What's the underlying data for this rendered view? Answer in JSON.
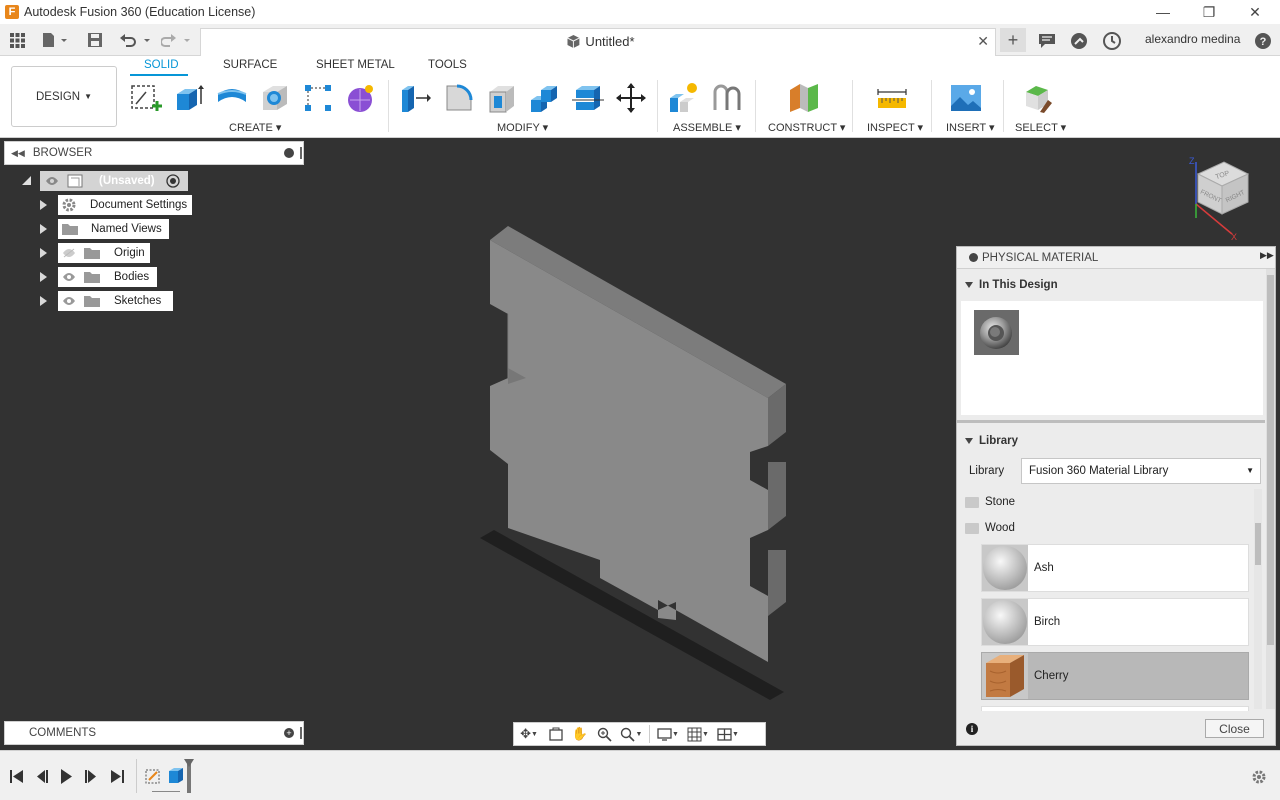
{
  "app": {
    "title": "Autodesk Fusion 360 (Education License)",
    "logo_letter": "F"
  },
  "document": {
    "tab_title": "Untitled*"
  },
  "user": {
    "name": "alexandro medina"
  },
  "workspace": {
    "design_label": "DESIGN"
  },
  "tabs": [
    {
      "label": "SOLID",
      "active": true
    },
    {
      "label": "SURFACE"
    },
    {
      "label": "SHEET METAL"
    },
    {
      "label": "TOOLS"
    }
  ],
  "toolbar_groups": {
    "create": "CREATE",
    "modify": "MODIFY",
    "assemble": "ASSEMBLE",
    "construct": "CONSTRUCT",
    "inspect": "INSPECT",
    "insert": "INSERT",
    "select": "SELECT"
  },
  "browser": {
    "title": "BROWSER",
    "root": "(Unsaved)",
    "items": [
      {
        "label": "Document Settings"
      },
      {
        "label": "Named Views"
      },
      {
        "label": "Origin"
      },
      {
        "label": "Bodies"
      },
      {
        "label": "Sketches"
      }
    ]
  },
  "comments": {
    "title": "COMMENTS"
  },
  "physical_material": {
    "title": "PHYSICAL MATERIAL",
    "in_this_design": "In This Design",
    "library_section": "Library",
    "library_label": "Library",
    "library_value": "Fusion 360 Material Library",
    "folders": [
      "Stone",
      "Wood"
    ],
    "materials": [
      {
        "name": "Ash"
      },
      {
        "name": "Birch"
      },
      {
        "name": "Cherry",
        "selected": true
      }
    ],
    "close_label": "Close"
  },
  "viewcube": {
    "top": "TOP",
    "front": "FRONT",
    "right": "RIGHT",
    "x_axis": "X",
    "z_axis": "Z"
  },
  "colors": {
    "accent": "#0696d7",
    "viewport": "#323232",
    "body": "#8a8a8a"
  }
}
